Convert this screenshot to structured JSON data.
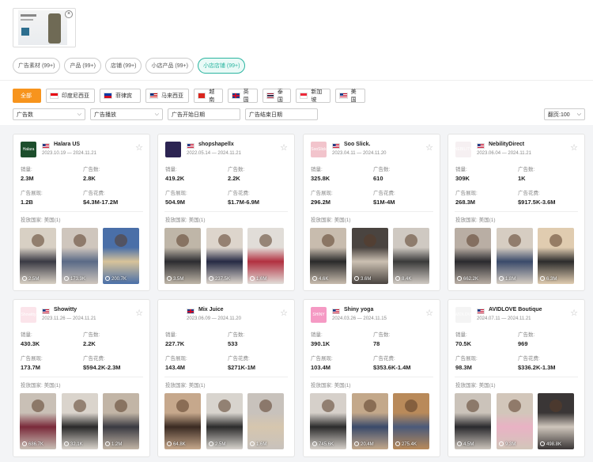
{
  "search_thumb": {
    "close_label": "×"
  },
  "chips": [
    {
      "label": "广告素材 (99+)",
      "active": false
    },
    {
      "label": "产品 (99+)",
      "active": false
    },
    {
      "label": "店铺 (99+)",
      "active": false
    },
    {
      "label": "小店产品 (99+)",
      "active": false
    },
    {
      "label": "小店店铺 (99+)",
      "active": true
    }
  ],
  "countries": [
    {
      "label": "全部",
      "all": true
    },
    {
      "label": "印度尼西亚",
      "flag": "id"
    },
    {
      "label": "菲律宾",
      "flag": "ph"
    },
    {
      "label": "马来西亚",
      "flag": "my"
    },
    {
      "label": "越南",
      "flag": "vn"
    },
    {
      "label": "英国",
      "flag": "gb"
    },
    {
      "label": "泰国",
      "flag": "th"
    },
    {
      "label": "新加坡",
      "flag": "sg"
    },
    {
      "label": "美国",
      "flag": "us"
    }
  ],
  "filters": {
    "ad_count": "广告数",
    "ad_plays": "广告播放",
    "start_date": "广告开始日期",
    "end_date": "广告结束日期",
    "page_size": "翻页:100"
  },
  "labels": {
    "sales": "销量:",
    "ads": "广告数:",
    "impressions": "广告展现:",
    "spend": "广告花费:",
    "country": "投放国家: 美国(1)"
  },
  "cards": [
    {
      "name": "Halara US",
      "flag": "us",
      "date_start": "2023.10.19",
      "date_end": "2024.11.21",
      "logo_text": "Halara",
      "logo_color": "#1d4e2c",
      "sales": "2.3M",
      "ads": "2.8K",
      "impressions": "1.2B",
      "spend": "$4.3M-17.2M",
      "videos": [
        {
          "views": "2.5M",
          "c1": "#d8d0c4",
          "c2": "#3a3a44"
        },
        {
          "views": "173.9K",
          "c1": "#cfc6bd",
          "c2": "#5a6a86"
        },
        {
          "views": "200.7K",
          "c1": "#4a6fa8",
          "c2": "#d8c39a"
        }
      ]
    },
    {
      "name": "shopshapellx",
      "flag": "us",
      "date_start": "2022.05.14",
      "date_end": "2024.11.21",
      "logo_text": "",
      "logo_color": "#2c2452",
      "sales": "419.2K",
      "ads": "2.2K",
      "impressions": "504.9M",
      "spend": "$1.7M-6.9M",
      "videos": [
        {
          "views": "3.5M",
          "c1": "#bfb6a8",
          "c2": "#2c2c30"
        },
        {
          "views": "237.5K",
          "c1": "#ddd5cc",
          "c2": "#262a44"
        },
        {
          "views": "1.6M",
          "c1": "#e1ddd8",
          "c2": "#b23040"
        }
      ]
    },
    {
      "name": "Soo Slick.",
      "flag": "us",
      "date_start": "2023.04.11",
      "date_end": "2024.11.20",
      "logo_text": "SooSlick",
      "logo_color": "#f2c4cc",
      "sales": "325.8K",
      "ads": "610",
      "impressions": "296.2M",
      "spend": "$1M-4M",
      "videos": [
        {
          "views": "4.6K",
          "c1": "#c8bcae",
          "c2": "#2a2a2a"
        },
        {
          "views": "3.6M",
          "c1": "#4a4440",
          "c2": "#cbc0b2"
        },
        {
          "views": "8.4K",
          "c1": "#cfc9c2",
          "c2": "#3a3a3a"
        }
      ]
    },
    {
      "name": "NebilityDirect",
      "flag": "us",
      "date_start": "2023.06.04",
      "date_end": "2024.11.21",
      "logo_text": "NEBILITY",
      "logo_color": "#f6f0f2",
      "sales": "309K",
      "ads": "1K",
      "impressions": "268.3M",
      "spend": "$917.5K-3.6M",
      "videos": [
        {
          "views": "662.2K",
          "c1": "#b9aea4",
          "c2": "#2a2a2e"
        },
        {
          "views": "1.8M",
          "c1": "#d6cdc2",
          "c2": "#3a4a6a"
        },
        {
          "views": "6.3M",
          "c1": "#e0ccb0",
          "c2": "#2c2c2c"
        }
      ]
    },
    {
      "name": "Showitty",
      "flag": "us",
      "date_start": "2023.11.26",
      "date_end": "2024.11.21",
      "logo_text": "Showitty",
      "logo_color": "#fbe4ea",
      "sales": "430.3K",
      "ads": "2.2K",
      "impressions": "173.7M",
      "spend": "$594.2K-2.3M",
      "videos": [
        {
          "views": "686.7K",
          "c1": "#c9c0b6",
          "c2": "#7a2a3a"
        },
        {
          "views": "32.1K",
          "c1": "#dad4cc",
          "c2": "#2a2a2a"
        },
        {
          "views": "1.2M",
          "c1": "#c2b5a6",
          "c2": "#3a3a42"
        }
      ]
    },
    {
      "name": "Mix Juice",
      "flag": "gb",
      "date_start": "2023.06.09",
      "date_end": "2024.11.20",
      "logo_text": "",
      "logo_color": "#ffffff",
      "sales": "227.7K",
      "ads": "533",
      "impressions": "143.4M",
      "spend": "$271K-1M",
      "videos": [
        {
          "views": "64.8K",
          "c1": "#c6a88c",
          "c2": "#3a2a22"
        },
        {
          "views": "2.5M",
          "c1": "#d8d4ce",
          "c2": "#2c2c2c"
        },
        {
          "views": "1.6M",
          "c1": "#c8c2bc",
          "c2": "#d6c6ae"
        }
      ]
    },
    {
      "name": "Shiny yoga",
      "flag": "us",
      "date_start": "2024.03.26",
      "date_end": "2024.11.15",
      "logo_text": "SHINY",
      "logo_color": "#f59ac4",
      "sales": "390.1K",
      "ads": "78",
      "impressions": "103.4M",
      "spend": "$353.6K-1.4M",
      "videos": [
        {
          "views": "745.6K",
          "c1": "#d6d0ca",
          "c2": "#2c2c2c"
        },
        {
          "views": "20.4M",
          "c1": "#c3a88a",
          "c2": "#3a4a6a"
        },
        {
          "views": "275.4K",
          "c1": "#b98a5a",
          "c2": "#4a5a7a"
        }
      ]
    },
    {
      "name": "AVIDLOVE Boutique",
      "flag": "us",
      "date_start": "2024.07.11",
      "date_end": "2024.11.21",
      "logo_text": "AVIDLOVE",
      "logo_color": "#f4f4f4",
      "sales": "70.5K",
      "ads": "969",
      "impressions": "98.3M",
      "spend": "$336.2K-1.3M",
      "videos": [
        {
          "views": "4.5M",
          "c1": "#cbc3ba",
          "c2": "#2a2a2e"
        },
        {
          "views": "9.3M",
          "c1": "#d2c6ba",
          "c2": "#e9b2c4"
        },
        {
          "views": "498.8K",
          "c1": "#3a3636",
          "c2": "#cfc6bc"
        }
      ]
    }
  ]
}
